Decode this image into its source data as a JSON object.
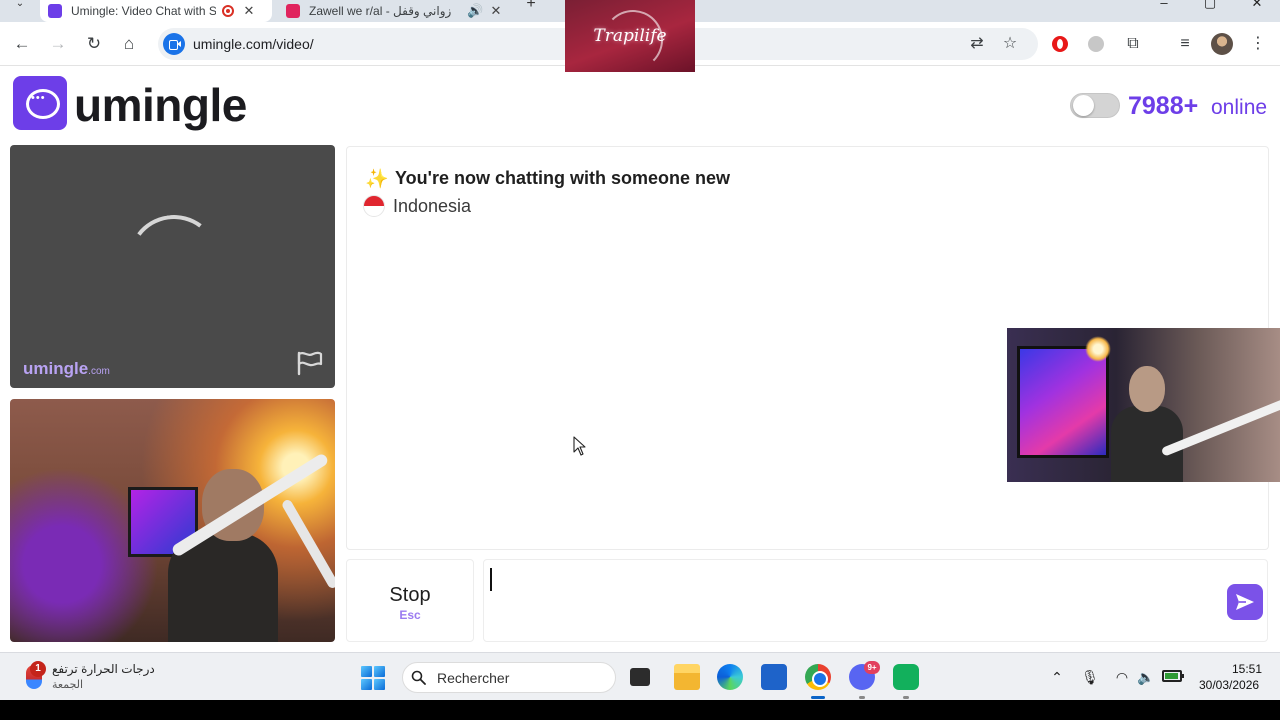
{
  "browser": {
    "tabs": [
      {
        "title": "Umingle: Video Chat with St",
        "active": true,
        "favicon_color": "#6d3ee8"
      },
      {
        "title": "Zawell we r/al - زواني وقفل",
        "active": false,
        "favicon_color": "#e0245e"
      }
    ],
    "url": "umingle.com/video/"
  },
  "overlay": {
    "logo_text": "Trapilife"
  },
  "header": {
    "brand": "umingle",
    "online_count": "7988+",
    "online_label": "online",
    "accent": "#6d3ee8"
  },
  "stranger_panel": {
    "watermark_name": "umingle",
    "watermark_domain": ".com"
  },
  "chat": {
    "sparkle_icon": "✨",
    "message": "You're now chatting with someone new",
    "country": "Indonesia"
  },
  "controls": {
    "stop_label": "Stop",
    "stop_shortcut": "Esc",
    "message_value": ""
  },
  "taskbar": {
    "weather_badge": "1",
    "weather_title": "درجات الحرارة ترتفع",
    "weather_subtitle": "الجمعة",
    "search_placeholder": "Rechercher",
    "discord_badge": "9+",
    "time": "15:51",
    "date": "30/03/2026"
  }
}
